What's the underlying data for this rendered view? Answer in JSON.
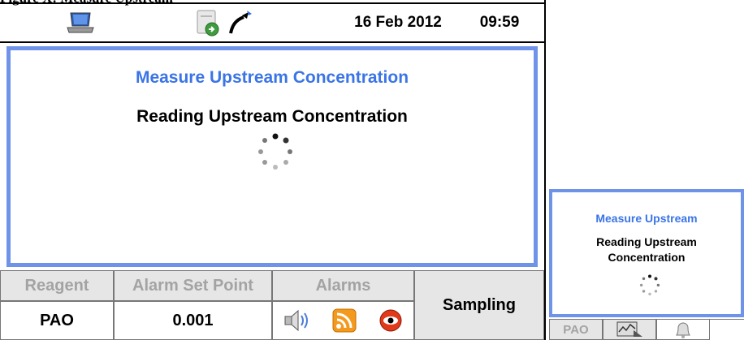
{
  "caption": "Figure X: Measure Upstream",
  "status_bar": {
    "date": "16 Feb 2012",
    "time": "09:59",
    "icons": [
      "laptop-icon",
      "export-document-icon",
      "probe-icon"
    ]
  },
  "main_panel": {
    "title": "Measure Upstream Concentration",
    "message": "Reading Upstream Concentration"
  },
  "info_table": {
    "headers": [
      "Reagent",
      "Alarm Set Point",
      "Alarms"
    ],
    "values": [
      "PAO",
      "0.001"
    ],
    "alarm_icons": [
      "speaker-icon",
      "rss-icon",
      "eye-icon"
    ],
    "action_button": "Sampling"
  },
  "thumbnail": {
    "title": "Measure Upstream",
    "message_line1": "Reading Upstream",
    "message_line2": "Concentration",
    "bar": [
      "PAO",
      "chart-icon",
      "bell-icon"
    ]
  },
  "colors": {
    "accent": "#3a74e6",
    "border": "#6f93e8",
    "header_bg": "#e6e6e6",
    "header_text": "#a3a3a3"
  }
}
